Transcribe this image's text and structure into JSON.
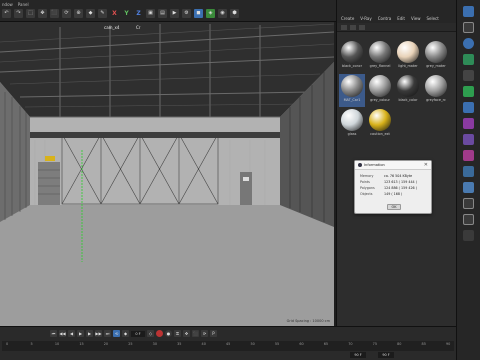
{
  "menubar": {
    "items": [
      "ndow",
      "Panel"
    ]
  },
  "toolbar": {
    "axis_x": "X",
    "axis_y": "Y",
    "axis_z": "Z"
  },
  "viewport": {
    "camera_label": "cam_x4",
    "second_label": "Cr",
    "grid_spacing": "Grid Spacing : 10000 cm"
  },
  "material_panel": {
    "menu": [
      "Create",
      "V-Ray",
      "Contra",
      "Edit",
      "View",
      "Select"
    ],
    "materials": [
      {
        "label": "black_concr",
        "color": "#555555",
        "selected": false
      },
      {
        "label": "grey_flannel",
        "color": "#777777",
        "selected": false
      },
      {
        "label": "light_mater",
        "color": "#e8d2b8",
        "selected": false
      },
      {
        "label": "grey_mater",
        "color": "#888888",
        "selected": false
      },
      {
        "label": "MAT_Car1",
        "color": "#8a8a8a",
        "selected": true
      },
      {
        "label": "grey_colour",
        "color": "#9a9a9a",
        "selected": false
      },
      {
        "label": "black_color",
        "color": "#3a3a3a",
        "selected": false
      },
      {
        "label": "greyface_rc",
        "color": "#a0a0a0",
        "selected": false
      },
      {
        "label": "glass",
        "color": "#cfd6da",
        "selected": false
      },
      {
        "label": "caution_ext",
        "color": "#d8b21a",
        "selected": false
      }
    ]
  },
  "info_dialog": {
    "title": "Information",
    "close": "✕",
    "rows": [
      {
        "k": "Memory",
        "v": "ca. 76 504 KByte"
      },
      {
        "k": "Points",
        "v": "123 613 ( 159 444 )"
      },
      {
        "k": "Polygons",
        "v": "124 886 ( 159 426 )"
      },
      {
        "k": "Objects",
        "v": "149 ( 168 )"
      }
    ],
    "ok_label": "OK"
  },
  "timeline": {
    "current_frame": "0 F",
    "ticks": [
      "0",
      "5",
      "10",
      "15",
      "20",
      "25",
      "30",
      "35",
      "40",
      "45",
      "50",
      "55",
      "60",
      "65",
      "70",
      "75",
      "80",
      "85",
      "90"
    ],
    "start_field": "90 F",
    "end_field": "90 F"
  },
  "colors": {
    "accent": "#3c5a8a",
    "record": "#bb3333"
  }
}
